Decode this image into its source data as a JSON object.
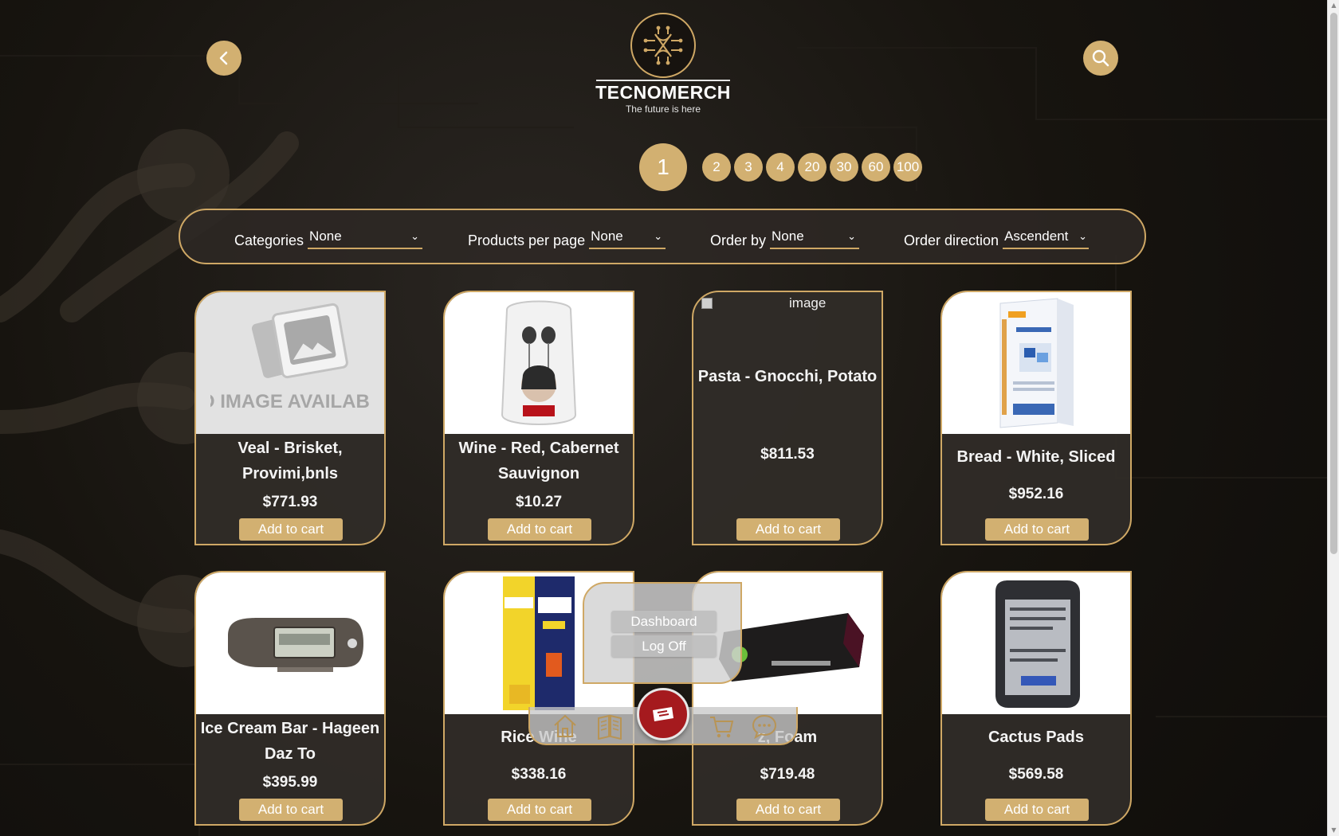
{
  "brand": {
    "title": "TECNOMERCH",
    "tagline": "The future is here"
  },
  "header": {
    "back_icon": "chevron-left-icon",
    "search_icon": "search-icon"
  },
  "pagination": {
    "current": "1",
    "pages": [
      "2",
      "3",
      "4",
      "20",
      "30",
      "60",
      "100"
    ]
  },
  "filters": {
    "categories": {
      "label": "Categories",
      "value": "None"
    },
    "per_page": {
      "label": "Products per page",
      "value": "None"
    },
    "order_by": {
      "label": "Order by",
      "value": "None"
    },
    "order_direction": {
      "label": "Order direction",
      "value": "Ascendent"
    }
  },
  "products": [
    {
      "name": "Veal - Brisket, Provimi,bnls",
      "price": "$771.93",
      "cart_label": "Add to cart",
      "image": "no-image",
      "no_image_text": "NO IMAGE AVAILABLE"
    },
    {
      "name": "Wine - Red, Cabernet Sauvignon",
      "price": "$10.27",
      "cart_label": "Add to cart",
      "image": "earphones"
    },
    {
      "name": "Pasta - Gnocchi, Potato",
      "price": "$811.53",
      "cart_label": "Add to cart",
      "image": "broken",
      "alt_text": "image"
    },
    {
      "name": "Bread - White, Sliced",
      "price": "$952.16",
      "cart_label": "Add to cart",
      "image": "usb-box"
    },
    {
      "name": "Ice Cream Bar - Hageen Daz To",
      "price": "$395.99",
      "cart_label": "Add to cart",
      "image": "mp3-player"
    },
    {
      "name": "Rice Wine",
      "price": "$338.16",
      "cart_label": "Add to cart",
      "image": "ink-cartridge"
    },
    {
      "name": "z, Foam",
      "price": "$719.48",
      "cart_label": "Add to cart",
      "image": "mini-pc"
    },
    {
      "name": "Cactus Pads",
      "price": "$569.58",
      "cart_label": "Add to cart",
      "image": "battery"
    }
  ],
  "user_menu": {
    "items": [
      "Dashboard",
      "Log Off"
    ]
  },
  "bottom_nav": {
    "icons": [
      "home-icon",
      "catalog-icon",
      "logo-button",
      "cart-icon",
      "chat-icon"
    ]
  },
  "colors": {
    "accent": "#d2b071",
    "background": "#141210",
    "center_button": "#a51a1e"
  }
}
